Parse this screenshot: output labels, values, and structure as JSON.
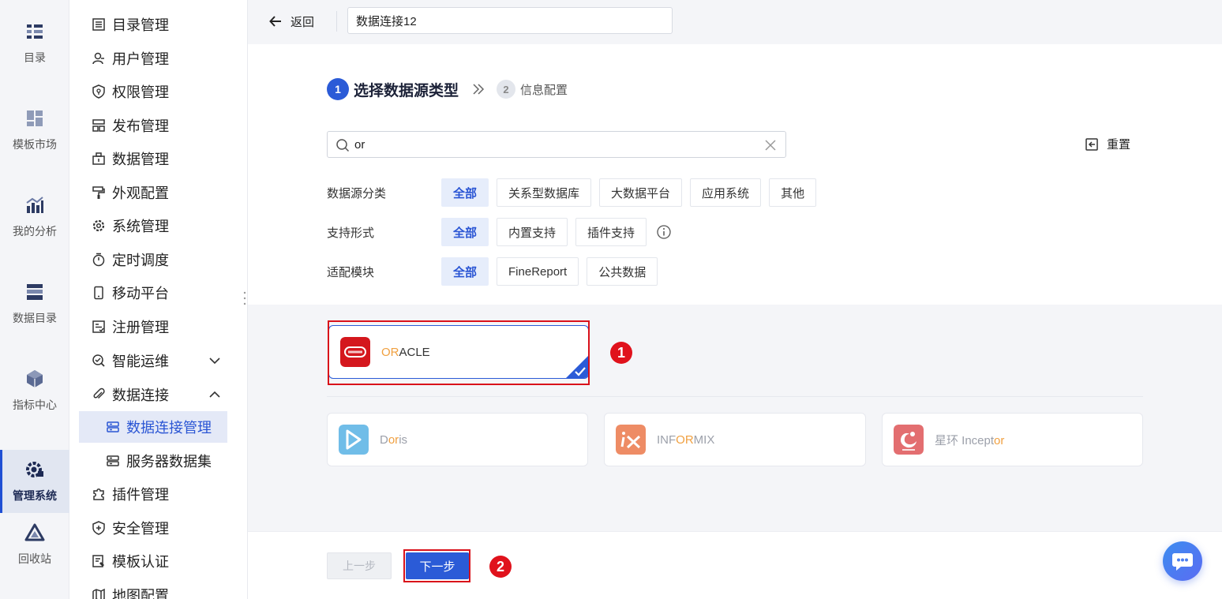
{
  "rail": {
    "items": [
      {
        "label": "目录",
        "icon": "catalog-icon"
      },
      {
        "label": "模板市场",
        "icon": "template-market-icon"
      },
      {
        "label": "我的分析",
        "icon": "analysis-icon"
      },
      {
        "label": "数据目录",
        "icon": "data-catalog-icon"
      },
      {
        "label": "指标中心",
        "icon": "metrics-icon"
      },
      {
        "label": "管理系统",
        "icon": "admin-gear-icon",
        "active": true
      },
      {
        "label": "回收站",
        "icon": "recycle-icon"
      }
    ]
  },
  "menu": {
    "items": [
      {
        "label": "目录管理"
      },
      {
        "label": "用户管理"
      },
      {
        "label": "权限管理"
      },
      {
        "label": "发布管理"
      },
      {
        "label": "数据管理"
      },
      {
        "label": "外观配置"
      },
      {
        "label": "系统管理"
      },
      {
        "label": "定时调度"
      },
      {
        "label": "移动平台"
      },
      {
        "label": "注册管理"
      },
      {
        "label": "智能运维"
      },
      {
        "label": "数据连接"
      },
      {
        "label": "插件管理"
      },
      {
        "label": "安全管理"
      },
      {
        "label": "模板认证"
      },
      {
        "label": "地图配置"
      }
    ],
    "sub": [
      {
        "label": "数据连接管理",
        "active": true
      },
      {
        "label": "服务器数据集"
      }
    ]
  },
  "topbar": {
    "back_label": "返回",
    "connection_name": "数据连接12"
  },
  "steps": {
    "step1_num": "1",
    "step1_title": "选择数据源类型",
    "step2_num": "2",
    "step2_title": "信息配置"
  },
  "search": {
    "value": "or",
    "reset_label": "重置"
  },
  "filters": {
    "category": {
      "label": "数据源分类",
      "options": [
        "全部",
        "关系型数据库",
        "大数据平台",
        "应用系统",
        "其他"
      ],
      "selected": "全部"
    },
    "support": {
      "label": "支持形式",
      "options": [
        "全部",
        "内置支持",
        "插件支持"
      ],
      "selected": "全部"
    },
    "module": {
      "label": "适配模块",
      "options": [
        "全部",
        "FineReport",
        "公共数据"
      ],
      "selected": "全部"
    }
  },
  "cards": {
    "selected": {
      "name_hl": "OR",
      "name_rest": "ACLE"
    },
    "others": [
      {
        "pre": "D",
        "hl": "or",
        "post": "is"
      },
      {
        "pre": "INF",
        "hl": "OR",
        "post": "MIX"
      },
      {
        "pre": "星环 Incept",
        "hl": "or",
        "post": ""
      }
    ]
  },
  "annotations": {
    "marker1": "1",
    "marker2": "2"
  },
  "footer": {
    "prev_label": "上一步",
    "next_label": "下一步"
  },
  "colors": {
    "primary": "#2b5bd7",
    "highlight": "#f0a040",
    "annotation_red": "#d9111a",
    "oracle_red": "#d4171d",
    "doris_blue": "#3aa5e0",
    "informix_orange": "#e8602a",
    "inceptor_red": "#d9373a"
  }
}
